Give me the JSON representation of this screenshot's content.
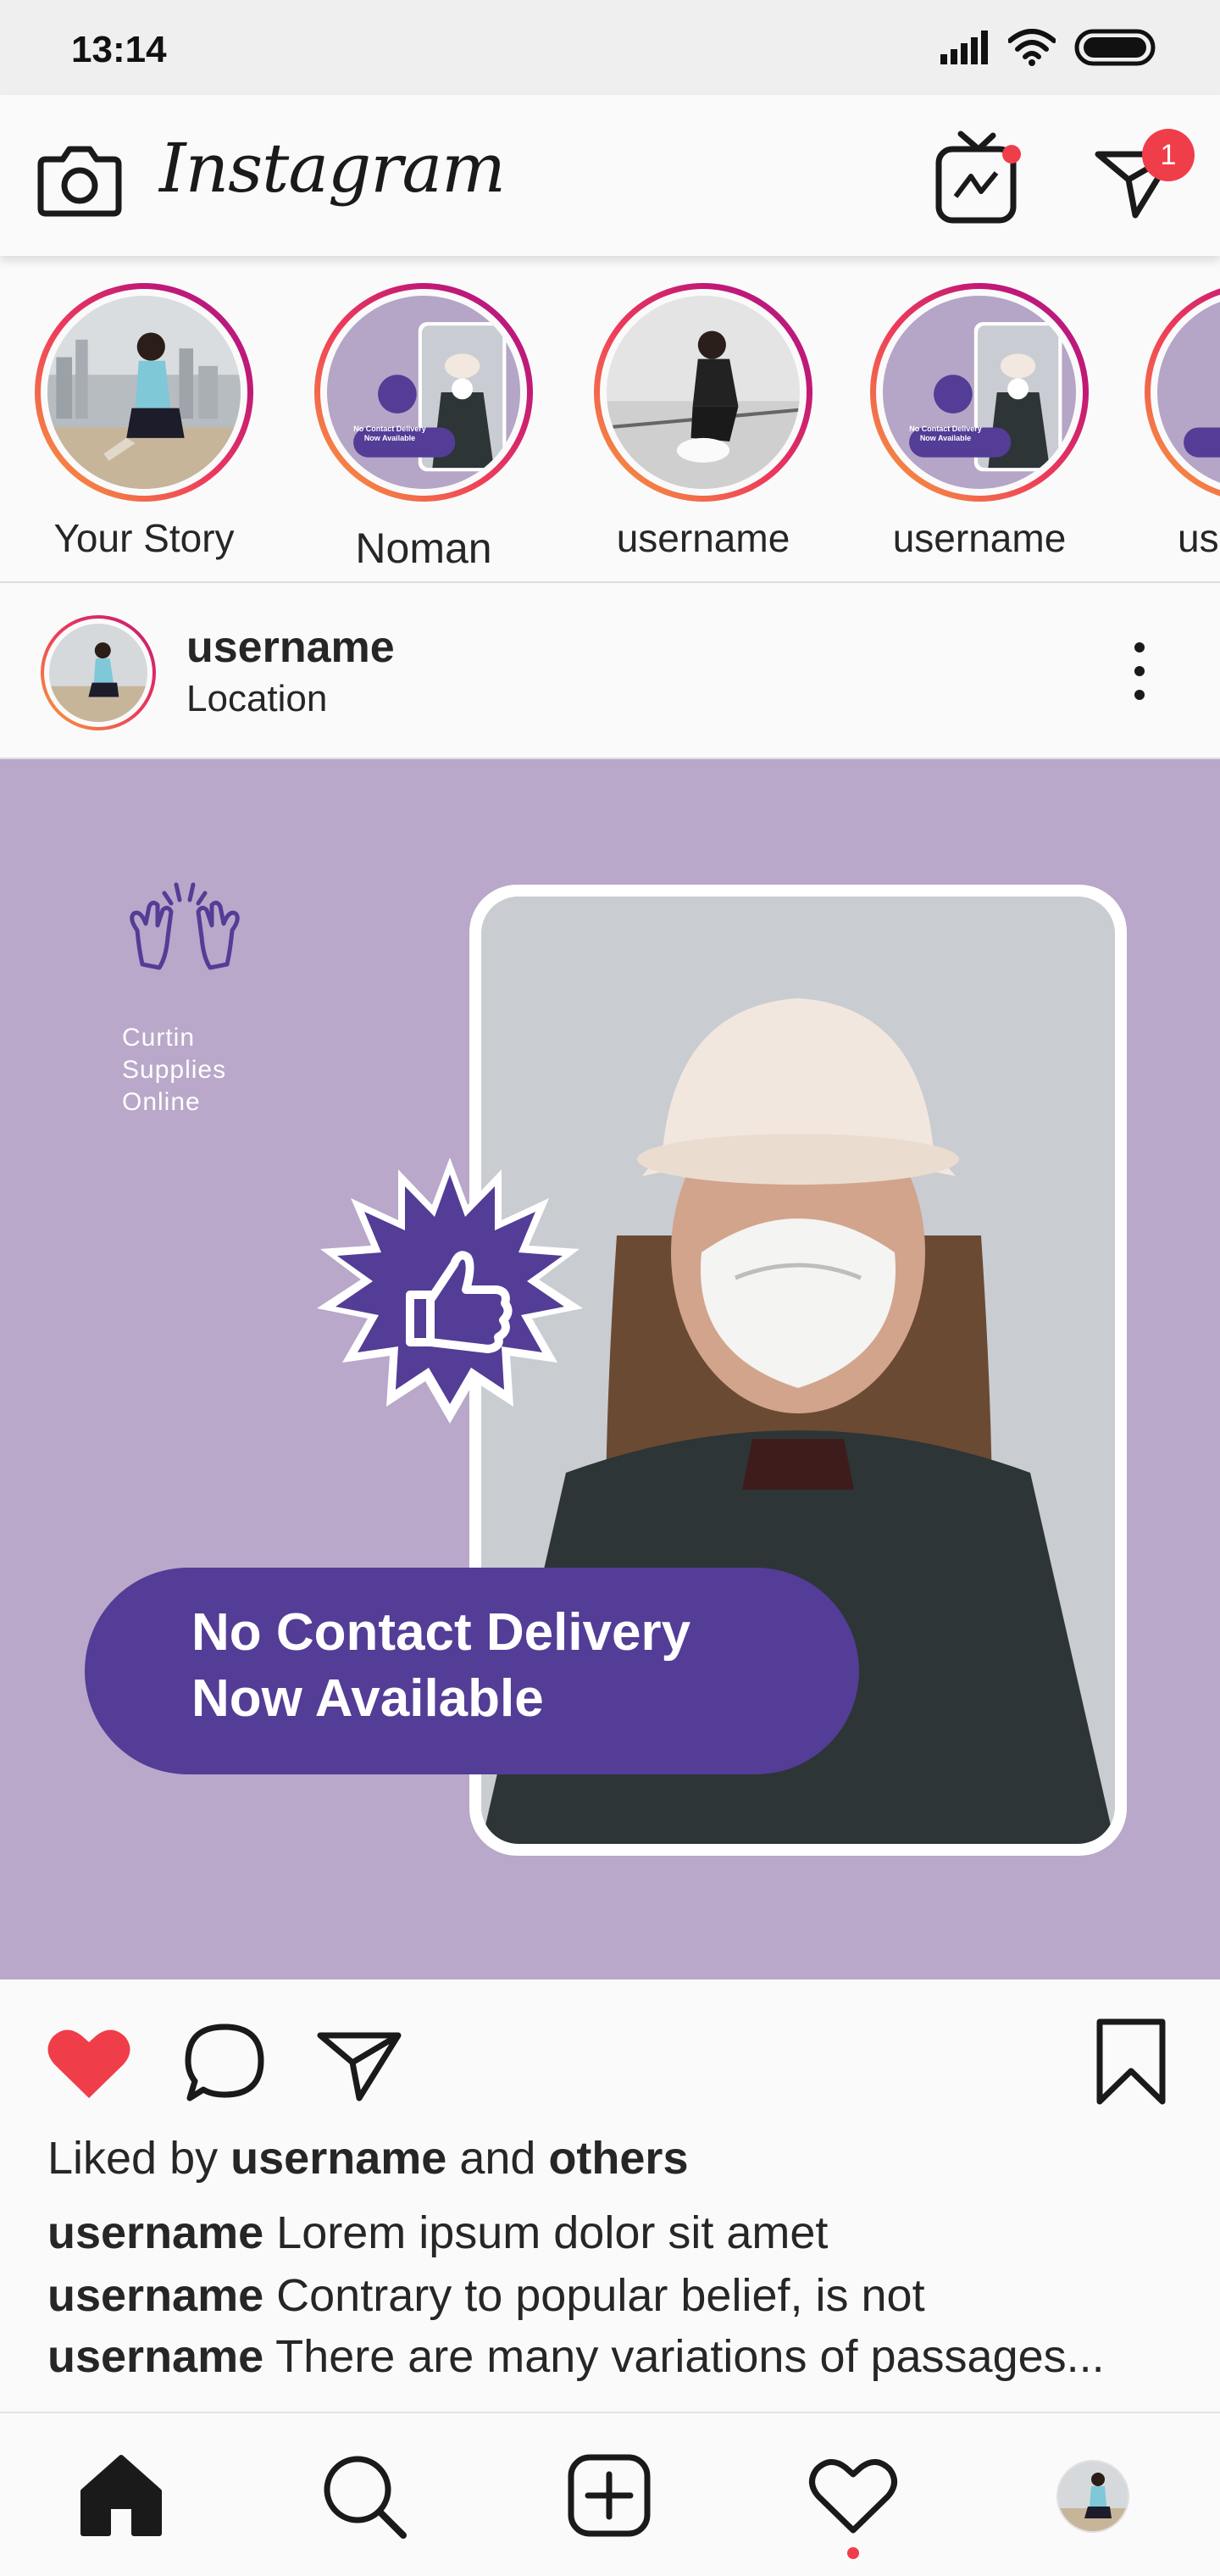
{
  "status_bar": {
    "time": "13:14"
  },
  "header": {
    "logo_text": "Instagram",
    "dm_badge_count": "1"
  },
  "stories": [
    {
      "label": "Your Story",
      "thumb": "city-girl"
    },
    {
      "label": "Noman",
      "thumb": "promo"
    },
    {
      "label": "username",
      "thumb": "sneakers"
    },
    {
      "label": "username",
      "thumb": "promo"
    },
    {
      "label": "username",
      "thumb": "promo"
    }
  ],
  "post": {
    "username": "username",
    "location": "Location",
    "image": {
      "brand_line1": "Curtin",
      "brand_line2": "Supplies",
      "brand_line3": "Online",
      "cta_line1": "No Contact Delivery",
      "cta_line2": "Now Available",
      "mini_cta": "No Contact Delivery Now Available"
    },
    "liked_prefix": "Liked by",
    "liked_user": "username",
    "liked_and": "and",
    "liked_others": "others",
    "comments": [
      {
        "user": "username",
        "text": "Lorem ipsum dolor sit amet"
      },
      {
        "user": "username",
        "text": "Contrary to popular belief, is not"
      },
      {
        "user": "username",
        "text": "There are many variations of passages..."
      }
    ],
    "liked": true
  },
  "colors": {
    "accent_red": "#ef3e4a",
    "post_bg": "#b9a8c9",
    "cta_purple": "#533d96",
    "story_gradient": [
      "#f7a439",
      "#ee3b5a",
      "#c21975"
    ]
  },
  "icons": {
    "header_left": "camera-icon",
    "header_right": [
      "igtv-icon",
      "direct-message-icon"
    ],
    "post_actions": [
      "heart-filled-icon",
      "comment-icon",
      "share-icon",
      "bookmark-icon"
    ],
    "nav": [
      "home-icon",
      "search-icon",
      "new-post-icon",
      "activity-heart-icon",
      "profile-avatar"
    ]
  }
}
